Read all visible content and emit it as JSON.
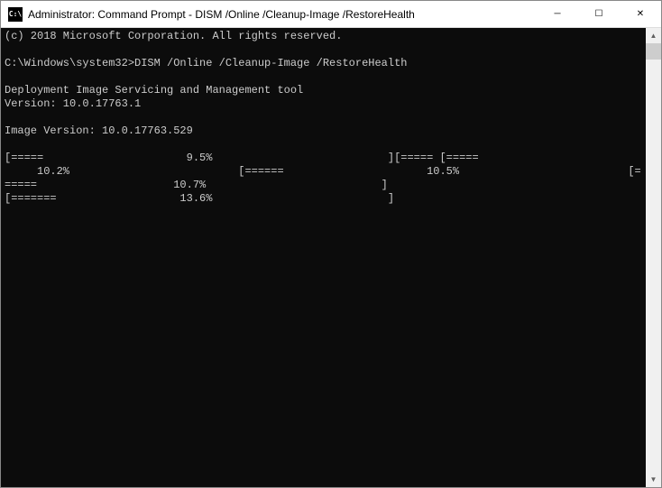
{
  "window": {
    "icon_label": "C:\\",
    "title": "Administrator: Command Prompt - DISM  /Online /Cleanup-Image /RestoreHealth",
    "controls": {
      "minimize": "─",
      "maximize": "☐",
      "close": "✕"
    }
  },
  "terminal": {
    "lines": [
      "(c) 2018 Microsoft Corporation. All rights reserved.",
      "",
      "C:\\Windows\\system32>DISM /Online /Cleanup-Image /RestoreHealth",
      "",
      "Deployment Image Servicing and Management tool",
      "Version: 10.0.17763.1",
      "",
      "Image Version: 10.0.17763.529",
      "",
      "[=====                      9.5%                           ][===== [=====",
      "     10.2%                          [======                      10.5%                          [=",
      "=====                     10.7%                           ]",
      "[=======                   13.6%                           ]"
    ]
  },
  "scrollbar": {
    "up": "▲",
    "down": "▼"
  }
}
